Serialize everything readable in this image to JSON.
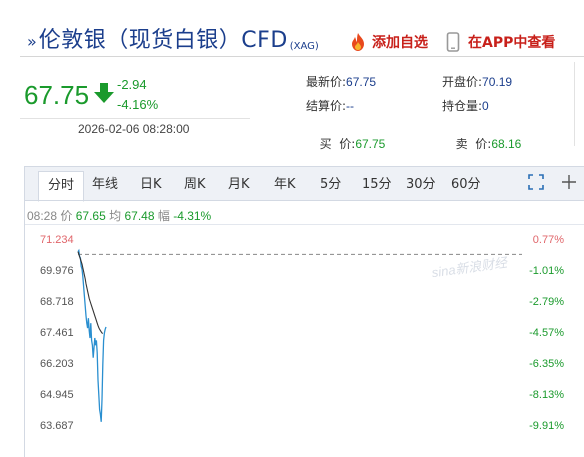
{
  "header": {
    "mark": "»",
    "title": "伦敦银（现货白银）CFD",
    "subtitle": "(XAG)",
    "add_watchlist": "添加自选",
    "open_app": "在APP中查看",
    "icons": {
      "add": "flame-icon",
      "app": "phone-icon"
    },
    "accent_color": "#c8201a",
    "title_color": "#1b3e8c"
  },
  "quote": {
    "price": "67.75",
    "change": "-2.94",
    "change_pct": "-4.16%",
    "datetime": "2026-02-06 08:28:00",
    "color": "#1a9a2c",
    "direction_icon": "down-arrow-icon"
  },
  "stats": {
    "latest_label": "最新价:",
    "latest": "67.75",
    "open_label": "开盘价:",
    "open": "70.19",
    "settle_label": "结算价:",
    "settle": "--",
    "oi_label": "持仓量:",
    "oi": "0",
    "buy_label": "买  价:",
    "buy": "67.75",
    "sell_label": "卖  价:",
    "sell": "68.16"
  },
  "tabs": [
    "分时",
    "年线",
    "日K",
    "周K",
    "月K",
    "年K",
    "5分",
    "15分",
    "30分",
    "60分"
  ],
  "active_tab": "分时",
  "toolbar_icons": [
    "fullscreen-icon",
    "crosshair-icon"
  ],
  "info_bar": {
    "time": "08:28",
    "price_label": "价",
    "price": "67.65",
    "avg_label": "均",
    "avg": "67.48",
    "amp_label": "幅",
    "amp": "-4.31%"
  },
  "watermark": "sina新浪财经",
  "chart_data": {
    "type": "line",
    "y_ticks": [
      "71.234",
      "69.976",
      "68.718",
      "67.461",
      "66.203",
      "64.945",
      "63.687"
    ],
    "pct_ticks": [
      "0.77%",
      "-1.01%",
      "-2.79%",
      "-4.57%",
      "-6.35%",
      "-8.13%",
      "-9.91%"
    ],
    "ylim": [
      63.687,
      71.234
    ],
    "reference": 70.69,
    "series": [
      {
        "role": "price",
        "color": "#2a8fd0",
        "values": [
          70.8,
          70.85,
          70.6,
          70.55,
          70.2,
          70.1,
          69.8,
          69.4,
          69.0,
          68.6,
          68.2,
          67.9,
          67.7,
          68.1,
          67.6,
          67.3,
          67.9,
          67.2,
          67.0,
          66.5,
          66.9,
          67.3,
          67.0,
          67.2,
          66.7,
          65.6,
          65.0,
          64.4,
          64.2,
          63.9,
          64.8,
          66.2,
          67.2,
          67.5,
          67.65,
          67.75
        ]
      },
      {
        "role": "average",
        "color": "#333333",
        "values": [
          70.8,
          70.7,
          70.6,
          70.5,
          70.4,
          70.3,
          70.15,
          70.0,
          69.85,
          69.7,
          69.5,
          69.35,
          69.2,
          69.05,
          68.9,
          68.8,
          68.7,
          68.6,
          68.5,
          68.4,
          68.3,
          68.2,
          68.1,
          68.0,
          67.9,
          67.8,
          67.72,
          67.65,
          67.6,
          67.55,
          67.5,
          67.48
        ]
      }
    ]
  }
}
